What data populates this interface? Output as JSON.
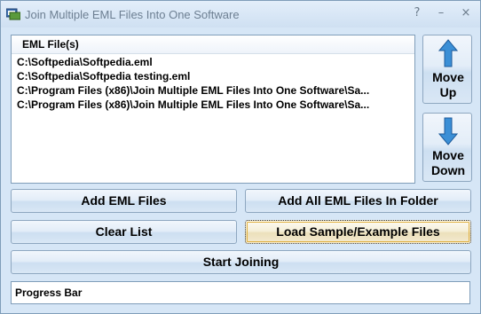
{
  "window": {
    "title": "Join Multiple EML Files Into One Software",
    "controls": [
      "?",
      "–",
      "×"
    ]
  },
  "file_list": {
    "header": "EML File(s)",
    "items": [
      "C:\\Softpedia\\Softpedia.eml",
      "C:\\Softpedia\\Softpedia testing.eml",
      "C:\\Program Files (x86)\\Join Multiple EML Files Into One Software\\Sa...",
      "C:\\Program Files (x86)\\Join Multiple EML Files Into One Software\\Sa..."
    ]
  },
  "side_buttons": {
    "move_up": {
      "line1": "Move",
      "line2": "Up"
    },
    "move_down": {
      "line1": "Move",
      "line2": "Down"
    }
  },
  "buttons": {
    "add_eml": "Add EML Files",
    "add_folder": "Add All EML Files In Folder",
    "clear": "Clear List",
    "load_sample": "Load Sample/Example Files",
    "start": "Start Joining"
  },
  "progress": {
    "label": "Progress Bar"
  },
  "colors": {
    "arrow": "#3b8fd6",
    "accent_focus": "#e0b040"
  }
}
